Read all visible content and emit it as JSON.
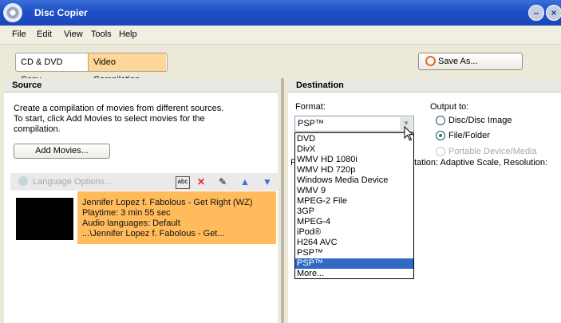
{
  "window": {
    "title": "Disc Copier",
    "minimize_icon": "minimize-icon",
    "close_icon": "close-icon"
  },
  "menu": [
    "File",
    "Edit",
    "View",
    "Tools",
    "Help"
  ],
  "toolbar": {
    "modes": [
      "CD & DVD Copy",
      "Video Compilation"
    ],
    "active_mode": "Video Compilation",
    "save_as_label": "Save As..."
  },
  "source": {
    "header": "Source",
    "description": "Create a compilation of movies from different sources.\nTo start, click Add Movies to select movies for the compilation.",
    "add_movies_label": "Add Movies...",
    "language_options_label": "Language Options...",
    "movies": [
      {
        "title": "Jennifer Lopez f. Fabolous - Get Right (WZ)",
        "playtime": "Playtime: 3 min 55 sec",
        "audio": "Audio languages: Default",
        "path": "...\\Jennifer Lopez f. Fabolous - Get..."
      }
    ]
  },
  "destination": {
    "header": "Destination",
    "format_label": "Format:",
    "format_value": "PSP™",
    "format_options": [
      "DVD",
      "DivX",
      "WMV HD 1080i",
      "WMV HD 720p",
      "Windows Media Device",
      "WMV 9",
      "MPEG-2 File",
      "3GP",
      "MPEG-4",
      "iPod®",
      "H264 AVC",
      "PSP™",
      "PSP™",
      "More..."
    ],
    "highlighted_option_index": 12,
    "output_label": "Output to:",
    "output_options": [
      {
        "label": "Disc/Disc Image",
        "selected": false,
        "enabled": true
      },
      {
        "label": "File/Folder",
        "selected": true,
        "enabled": true
      },
      {
        "label": "Portable Device/Media",
        "selected": false,
        "enabled": false
      }
    ],
    "adaptation_text": "ptation: Adaptive Scale, Resolution:",
    "fragment_left": "P"
  },
  "colors": {
    "titlebar": "#1f4fc9",
    "highlight_item": "#ffbb5c",
    "active_mode": "#ffd699",
    "selection": "#316ac5"
  }
}
